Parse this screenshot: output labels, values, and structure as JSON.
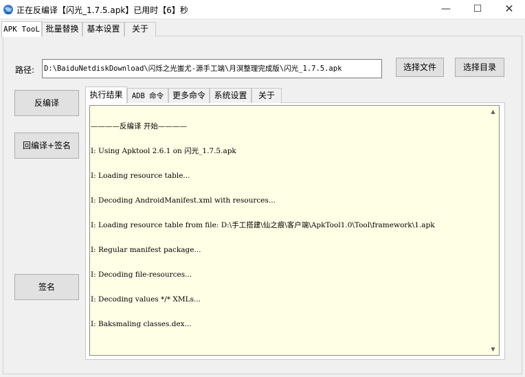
{
  "window": {
    "title": "正在反编译【闪光_1.7.5.apk】已用时【6】秒",
    "minimize_glyph": "—",
    "maximize_glyph": "☐",
    "close_glyph": "✕",
    "app_icon": "globe-icon"
  },
  "top_tabs": [
    {
      "label": "APK TooL",
      "active": true
    },
    {
      "label": "批量替换",
      "active": false
    },
    {
      "label": "基本设置",
      "active": false
    },
    {
      "label": "关于",
      "active": false
    }
  ],
  "path": {
    "label": "路径:",
    "value": "D:\\BaiduNetdiskDownload\\闪烁之光蚩尤-源手工端\\月溟整理完成版\\闪光_1.7.5.apk"
  },
  "buttons": {
    "select_file": "选择文件",
    "select_dir": "选择目录",
    "decompile": "反编译",
    "recompile_sign": "回编译+签名",
    "sign": "签名"
  },
  "inner_tabs": [
    {
      "label": "执行结果",
      "active": true
    },
    {
      "label": "ADB 命令",
      "active": false
    },
    {
      "label": "更多命令",
      "active": false
    },
    {
      "label": "系统设置",
      "active": false
    },
    {
      "label": "关于",
      "active": false
    }
  ],
  "log": [
    "————反编译 开始————",
    "I: Using Apktool 2.6.1 on 闪光_1.7.5.apk",
    "I: Loading resource table...",
    "I: Decoding AndroidManifest.xml with resources...",
    "I: Loading resource table from file: D:\\手工搭建\\仙之痕\\客户端\\ApkTool1.0\\Tool\\framework\\1.apk",
    "I: Regular manifest package...",
    "I: Decoding file-resources...",
    "I: Decoding values */* XMLs...",
    "I: Baksmaling classes.dex..."
  ],
  "scrollbar": {
    "up_glyph": "▲",
    "down_glyph": "▼"
  }
}
